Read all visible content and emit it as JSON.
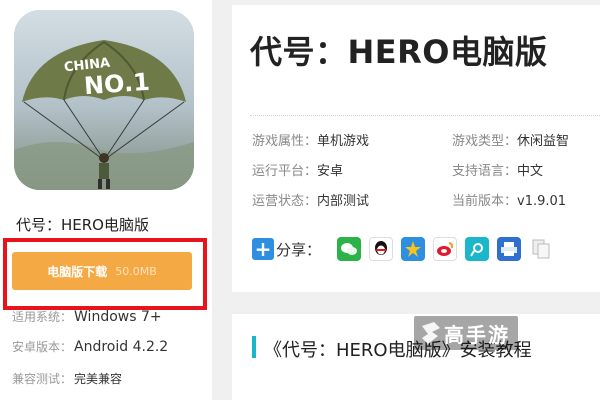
{
  "app": {
    "name": "代号：HERO电脑版",
    "icon_text_top": "CHINA",
    "icon_text_main": "NO.1"
  },
  "download": {
    "label": "电脑版下载",
    "size": "50.0MB"
  },
  "specs": [
    {
      "key": "适用系统：",
      "value": "Windows 7+"
    },
    {
      "key": "安卓版本：",
      "value": "Android 4.2.2"
    },
    {
      "key": "兼容测试：",
      "value": "完美兼容"
    }
  ],
  "header": {
    "title": "代号：HERO电脑版"
  },
  "info": {
    "attr_key": "游戏属性：",
    "attr_value": "单机游戏",
    "type_key": "游戏类型：",
    "type_value": "休闲益智",
    "platform_key": "运行平台：",
    "platform_value": "安卓",
    "lang_key": "支持语言：",
    "lang_value": "中文",
    "status_key": "运营状态：",
    "status_value": "内部测试",
    "version_key": "当前版本：",
    "version_value": "v1.9.01"
  },
  "share": {
    "label": "分享：",
    "icons": [
      "wechat-icon",
      "qq-icon",
      "qzone-icon",
      "weibo-icon",
      "tencent-weibo-icon",
      "print-icon",
      "copy-icon"
    ]
  },
  "tutorial": {
    "title": "《代号：HERO电脑版》安装教程"
  },
  "watermark": {
    "text": "高手游"
  },
  "colors": {
    "download_button": "#f5a944",
    "highlight_frame": "#e8141b",
    "accent": "#1bb6c9",
    "share_plus": "#2e8ee0"
  }
}
